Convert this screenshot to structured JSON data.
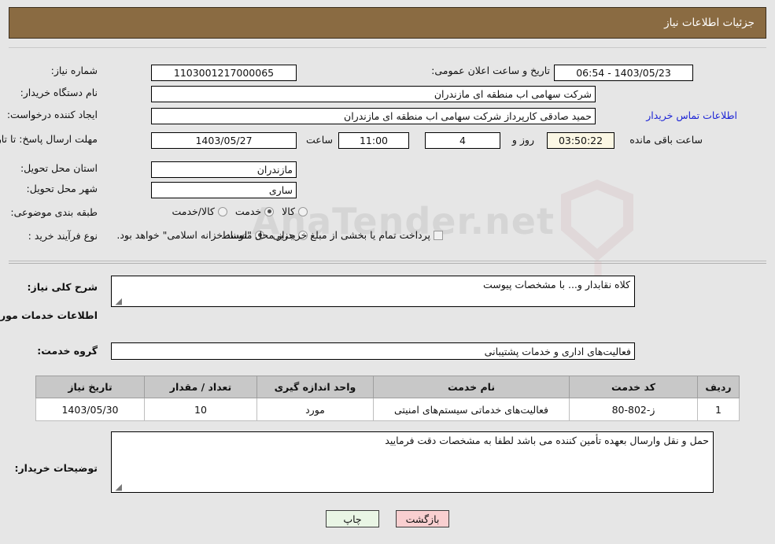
{
  "header": {
    "title": "جزئیات اطلاعات نیاز"
  },
  "top_form": {
    "need_number_label": "شماره نیاز:",
    "need_number_value": "1103001217000065",
    "announce_datetime_label": "تاریخ و ساعت اعلان عمومی:",
    "announce_datetime_value": "1403/05/23 - 06:54",
    "buyer_org_label": "نام دستگاه خریدار:",
    "buyer_org_value": "شرکت سهامی اب منطقه ای مازندران",
    "requester_label": "ایجاد کننده درخواست:",
    "requester_value": "حمید  صادقی کارپرداز شرکت سهامی اب منطقه ای مازندران",
    "contact_link": "اطلاعات تماس خریدار",
    "deadline_label": "مهلت ارسال پاسخ: تا تاریخ:",
    "deadline_date": "1403/05/27",
    "hour_label": "ساعت",
    "deadline_time": "11:00",
    "days_remaining": "4",
    "days_word": "روز و",
    "countdown": "03:50:22",
    "countdown_suffix": "ساعت باقی مانده",
    "province_label": "استان محل تحویل:",
    "province_value": "مازندران",
    "city_label": "شهر محل تحویل:",
    "city_value": "ساری",
    "category_label": "طبقه بندی موضوعی:",
    "category_options": [
      {
        "label": "کالا",
        "selected": false
      },
      {
        "label": "خدمت",
        "selected": true
      },
      {
        "label": "کالا/خدمت",
        "selected": false
      }
    ],
    "process_label": "نوع فرآیند خرید :",
    "process_options": [
      {
        "label": "جزیی",
        "selected": false
      },
      {
        "label": "متوسط",
        "selected": true
      }
    ],
    "treasury_checkbox_text": "پرداخت تمام یا بخشی از مبلغ خرید،از محل \"اسناد خزانه اسلامی\" خواهد بود.",
    "treasury_checked": false
  },
  "bottom": {
    "general_desc_label": "شرح کلی نیاز:",
    "general_desc_value": "کلاه نقابدار و... با مشخصات پیوست",
    "services_heading": "اطلاعات خدمات مورد نیاز",
    "service_group_label": "گروه خدمت:",
    "service_group_value": "فعالیت‌های اداری و خدمات پشتیبانی",
    "buyer_notes_label": "توضیحات خریدار:",
    "buyer_notes_value": "حمل و نقل وارسال بعهده تأمین کننده می باشد لطفا به مشخصات دقت فرمایید"
  },
  "table": {
    "columns": [
      "ردیف",
      "کد خدمت",
      "نام خدمت",
      "واحد اندازه گیری",
      "تعداد / مقدار",
      "تاریخ نیاز"
    ],
    "rows": [
      {
        "index": "1",
        "code": "ز-802-80",
        "name": "فعالیت‌های خدماتی سیستم‌های امنیتی",
        "unit": "مورد",
        "quantity": "10",
        "need_date": "1403/05/30"
      }
    ]
  },
  "buttons": {
    "print": "چاپ",
    "back": "بازگشت"
  },
  "watermark": {
    "text": "AnaTender.net"
  }
}
